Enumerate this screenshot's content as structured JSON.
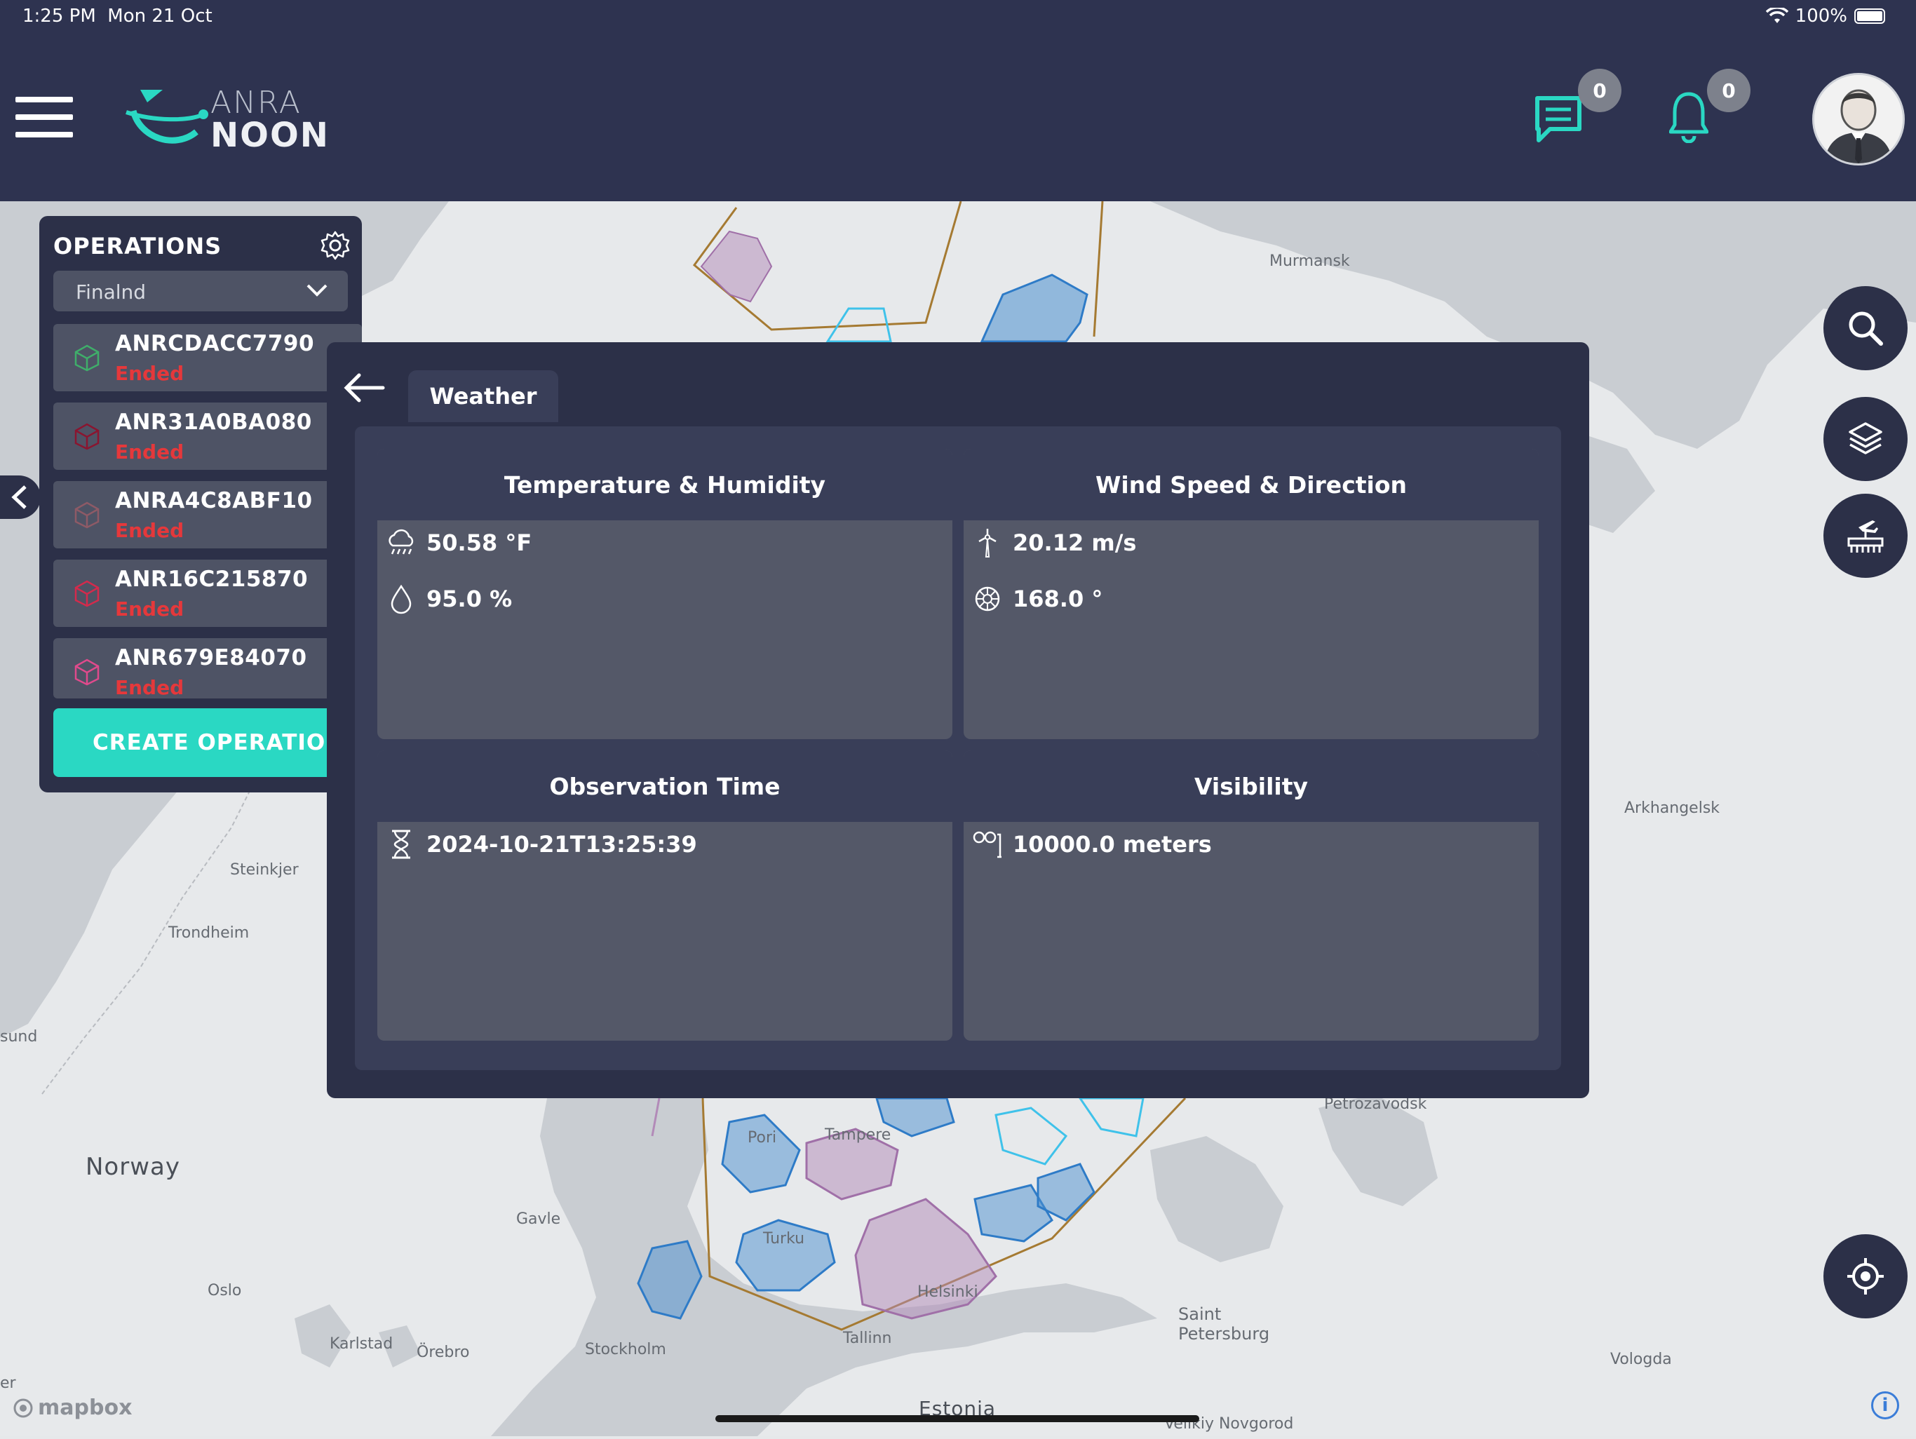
{
  "status_bar": {
    "time": "1:25 PM",
    "date": "Mon 21 Oct",
    "battery": "100%"
  },
  "header": {
    "logo_line1": "ANRA",
    "logo_line2": "NOON",
    "messages_count": "0",
    "notifications_count": "0",
    "icons": [
      "menu-icon",
      "chat-icon",
      "bell-icon",
      "user-avatar"
    ]
  },
  "operations": {
    "title": "OPERATIONS",
    "region": "Finalnd",
    "items": [
      {
        "id": "ANRCDACC7790",
        "status": "Ended",
        "icon_color": "#3fae6a"
      },
      {
        "id": "ANR31A0BA080",
        "status": "Ended",
        "icon_color": "#8a1530"
      },
      {
        "id": "ANRA4C8ABF10",
        "status": "Ended",
        "icon_color": "#8e5a66"
      },
      {
        "id": "ANR16C215870",
        "status": "Ended",
        "icon_color": "#d42a4c"
      },
      {
        "id": "ANR679E84070",
        "status": "Ended",
        "icon_color": "#e04a8c"
      }
    ],
    "create_label": "CREATE OPERATION"
  },
  "weather": {
    "tab_label": "Weather",
    "cards": {
      "temp_humidity": {
        "title": "Temperature & Humidity",
        "temperature": "50.58 °F",
        "humidity": "95.0 %"
      },
      "wind": {
        "title": "Wind Speed & Direction",
        "speed": "20.12 m/s",
        "direction": "168.0 °"
      },
      "observation": {
        "title": "Observation Time",
        "time": "2024-10-21T13:25:39"
      },
      "visibility": {
        "title": "Visibility",
        "value": "10000.0 meters"
      }
    }
  },
  "map": {
    "labels": [
      "Murmansk",
      "Arkhangelsk",
      "Steinkjer",
      "Trondheim",
      "Norway",
      "Gavle",
      "Oslo",
      "Karlstad",
      "Örebro",
      "Stockholm",
      "Pori",
      "Tampere",
      "Turku",
      "Helsinki",
      "Tallinn",
      "Estonia",
      "Saint",
      "Petersburg",
      "Petrozavodsk",
      "Vologda",
      "Velikiy Novgorod",
      "sund",
      "er"
    ],
    "attribution": "mapbox",
    "colors": {
      "land": "#e7e9eb",
      "water": "#c9cdd2",
      "flight_zone_blue": "#4b8fd0",
      "flight_zone_purple": "#b28ab8",
      "border_brown": "#a57a32",
      "outline_cyan": "#3fc2ea"
    }
  },
  "controls": [
    "search-icon",
    "layers-icon",
    "airport-icon",
    "locate-icon"
  ]
}
